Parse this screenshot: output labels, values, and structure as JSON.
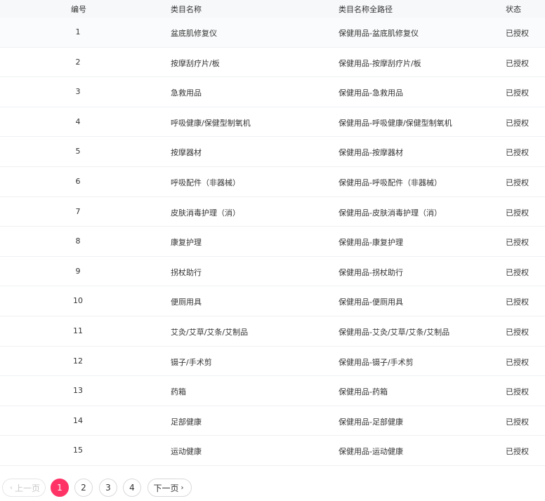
{
  "table": {
    "headers": {
      "id": "编号",
      "name": "类目名称",
      "path": "类目名称全路径",
      "status": "状态"
    },
    "rows": [
      {
        "id": "1",
        "name": "盆底肌修复仪",
        "path": "保健用品-盆底肌修复仪",
        "status": "已授权"
      },
      {
        "id": "2",
        "name": "按摩刮疗片/板",
        "path": "保健用品-按摩刮疗片/板",
        "status": "已授权"
      },
      {
        "id": "3",
        "name": "急救用品",
        "path": "保健用品-急救用品",
        "status": "已授权"
      },
      {
        "id": "4",
        "name": "呼吸健康/保健型制氧机",
        "path": "保健用品-呼吸健康/保健型制氧机",
        "status": "已授权"
      },
      {
        "id": "5",
        "name": "按摩器材",
        "path": "保健用品-按摩器材",
        "status": "已授权"
      },
      {
        "id": "6",
        "name": "呼吸配件（非器械）",
        "path": "保健用品-呼吸配件（非器械）",
        "status": "已授权"
      },
      {
        "id": "7",
        "name": "皮肤消毒护理（消）",
        "path": "保健用品-皮肤消毒护理（消）",
        "status": "已授权"
      },
      {
        "id": "8",
        "name": "康复护理",
        "path": "保健用品-康复护理",
        "status": "已授权"
      },
      {
        "id": "9",
        "name": "拐杖助行",
        "path": "保健用品-拐杖助行",
        "status": "已授权"
      },
      {
        "id": "10",
        "name": "便厕用具",
        "path": "保健用品-便厕用具",
        "status": "已授权"
      },
      {
        "id": "11",
        "name": "艾灸/艾草/艾条/艾制品",
        "path": "保健用品-艾灸/艾草/艾条/艾制品",
        "status": "已授权"
      },
      {
        "id": "12",
        "name": "镊子/手术剪",
        "path": "保健用品-镊子/手术剪",
        "status": "已授权"
      },
      {
        "id": "13",
        "name": "药箱",
        "path": "保健用品-药箱",
        "status": "已授权"
      },
      {
        "id": "14",
        "name": "足部健康",
        "path": "保健用品-足部健康",
        "status": "已授权"
      },
      {
        "id": "15",
        "name": "运动健康",
        "path": "保健用品-运动健康",
        "status": "已授权"
      }
    ]
  },
  "pagination": {
    "prev_label": "上一页",
    "next_label": "下一页",
    "pages": [
      "1",
      "2",
      "3",
      "4"
    ],
    "current": "1",
    "accent_color": "#ff3366",
    "prev_icon": "chevron-left-icon",
    "next_icon": "chevron-right-icon"
  }
}
